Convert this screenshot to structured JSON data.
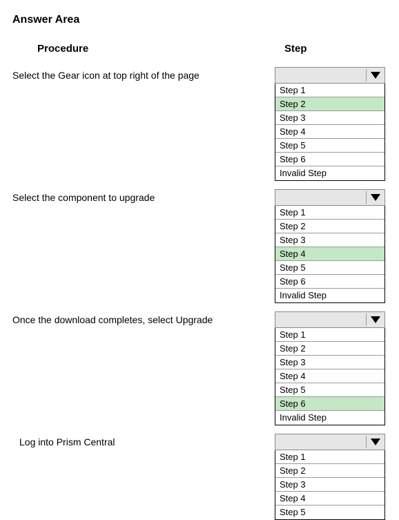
{
  "title": "Answer Area",
  "headers": {
    "procedure": "Procedure",
    "step": "Step"
  },
  "rows": [
    {
      "procedure": "Select the Gear icon at top right of the page",
      "indent": false,
      "options": [
        {
          "label": "Step 1",
          "selected": false
        },
        {
          "label": "Step 2",
          "selected": true
        },
        {
          "label": "Step 3",
          "selected": false
        },
        {
          "label": "Step 4",
          "selected": false
        },
        {
          "label": "Step 5",
          "selected": false
        },
        {
          "label": "Step 6",
          "selected": false
        },
        {
          "label": "Invalid Step",
          "selected": false
        }
      ]
    },
    {
      "procedure": "Select the component to upgrade",
      "indent": false,
      "options": [
        {
          "label": "Step 1",
          "selected": false
        },
        {
          "label": "Step 2",
          "selected": false
        },
        {
          "label": "Step 3",
          "selected": false
        },
        {
          "label": "Step 4",
          "selected": true
        },
        {
          "label": "Step 5",
          "selected": false
        },
        {
          "label": "Step 6",
          "selected": false
        },
        {
          "label": "Invalid Step",
          "selected": false
        }
      ]
    },
    {
      "procedure": "Once the download completes, select Upgrade",
      "indent": false,
      "options": [
        {
          "label": "Step 1",
          "selected": false
        },
        {
          "label": "Step 2",
          "selected": false
        },
        {
          "label": "Step 3",
          "selected": false
        },
        {
          "label": "Step 4",
          "selected": false
        },
        {
          "label": "Step 5",
          "selected": false
        },
        {
          "label": "Step 6",
          "selected": true
        },
        {
          "label": "Invalid Step",
          "selected": false
        }
      ]
    },
    {
      "procedure": "Log into Prism Central",
      "indent": true,
      "options": [
        {
          "label": "Step 1",
          "selected": false
        },
        {
          "label": "Step 2",
          "selected": false
        },
        {
          "label": "Step 3",
          "selected": false
        },
        {
          "label": "Step 4",
          "selected": false
        },
        {
          "label": "Step 5",
          "selected": false
        }
      ]
    }
  ]
}
